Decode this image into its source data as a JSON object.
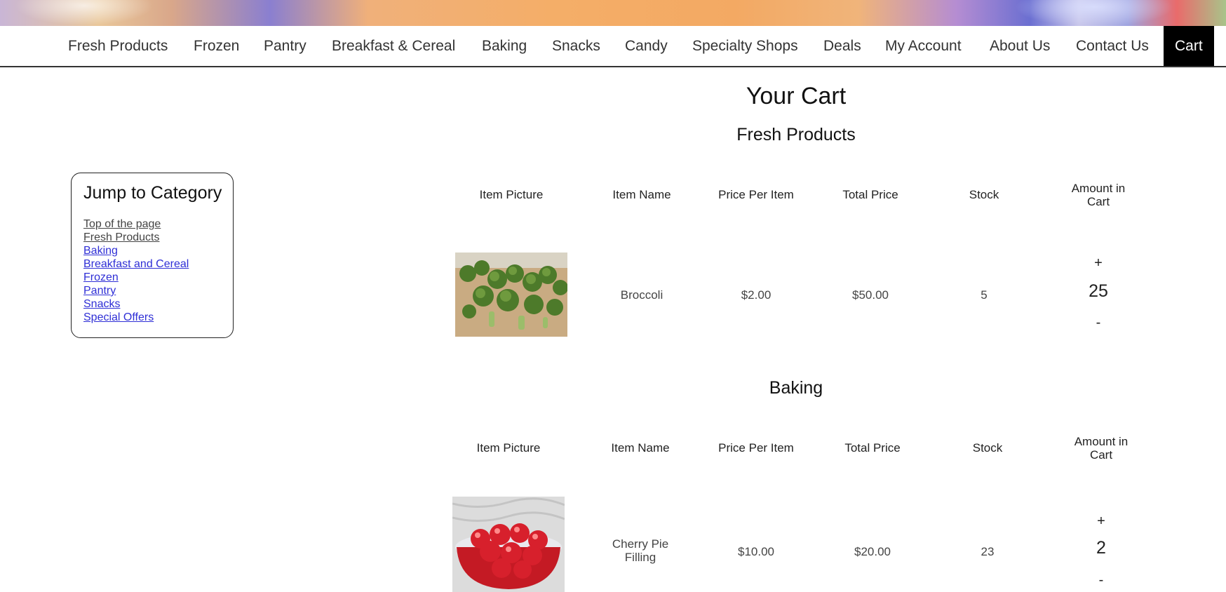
{
  "nav": {
    "items": [
      "Fresh Products",
      "Frozen",
      "Pantry",
      "Breakfast & Cereal",
      "Baking",
      "Snacks",
      "Candy",
      "Specialty Shops",
      "Deals",
      "My Account",
      "About Us",
      "Contact Us"
    ],
    "cart_label": "Cart"
  },
  "jump": {
    "title": "Jump to Category",
    "links": [
      "Top of the page",
      "Fresh Products",
      "Baking",
      "Breakfast and Cereal",
      "Frozen",
      "Pantry",
      "Snacks",
      "Special Offers"
    ]
  },
  "cart": {
    "title": "Your Cart",
    "columns": [
      "Item Picture",
      "Item Name",
      "Price Per Item",
      "Total Price",
      "Stock",
      "Amount in Cart"
    ],
    "plus": "+",
    "minus": "-",
    "sections": [
      {
        "name": "Fresh Products",
        "items": [
          {
            "name": "Broccoli",
            "price": "$2.00",
            "total": "$50.00",
            "stock": "5",
            "amount": "25",
            "image": "broccoli-photo"
          }
        ]
      },
      {
        "name": "Baking",
        "items": [
          {
            "name": "Cherry Pie Filling",
            "price": "$10.00",
            "total": "$20.00",
            "stock": "23",
            "amount": "2",
            "image": "cherry-pie-filling-photo"
          }
        ]
      }
    ]
  }
}
